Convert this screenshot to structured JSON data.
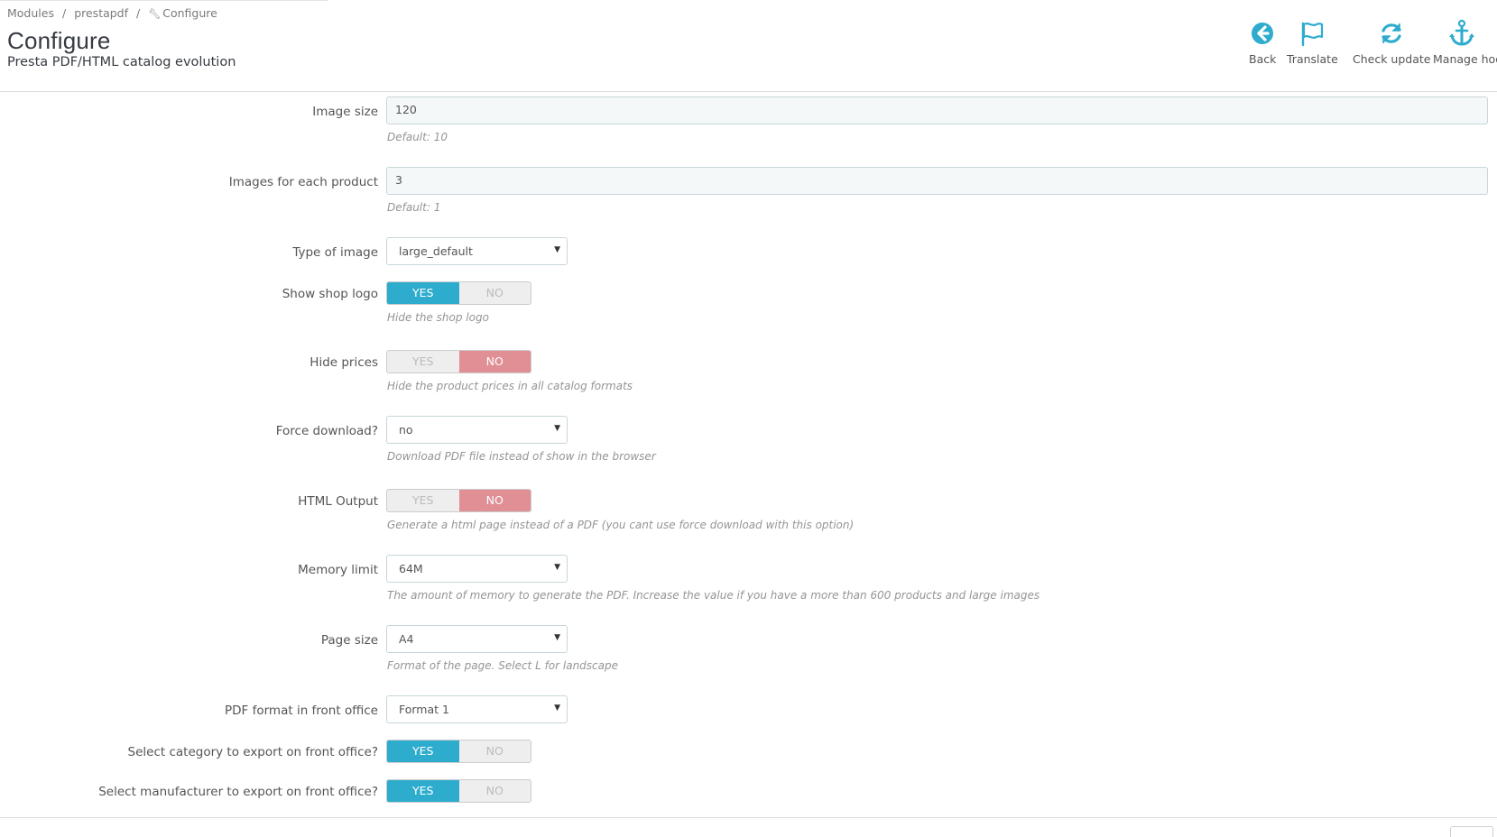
{
  "breadcrumb": {
    "items": [
      "Modules",
      "prestapdf"
    ],
    "separator": "/",
    "current": "Configure"
  },
  "header": {
    "title": "Configure",
    "subtitle": "Presta PDF/HTML catalog evolution"
  },
  "toolbar": {
    "accent_color": "#2eacce",
    "buttons": [
      {
        "label": "Back",
        "icon": "back-arrow-circle-icon"
      },
      {
        "label": "Translate",
        "icon": "flag-icon"
      },
      {
        "label": "Check update",
        "icon": "refresh-icon"
      },
      {
        "label": "Manage hoo",
        "icon": "anchor-icon"
      }
    ]
  },
  "form": {
    "image_size": {
      "label": "Image size",
      "value": "120",
      "help": "Default: 10"
    },
    "images_per_product": {
      "label": "Images for each product",
      "value": "3",
      "help": "Default: 1"
    },
    "image_type": {
      "label": "Type of image",
      "value": "large_default"
    },
    "show_logo": {
      "label": "Show shop logo",
      "yes": "YES",
      "no": "NO",
      "selected": "YES",
      "help": "Hide the shop logo"
    },
    "hide_prices": {
      "label": "Hide prices",
      "yes": "YES",
      "no": "NO",
      "selected": "NO",
      "help": "Hide the product prices in all catalog formats"
    },
    "force_download": {
      "label": "Force download?",
      "value": "no",
      "help": "Download PDF file instead of show in the browser"
    },
    "html_output": {
      "label": "HTML Output",
      "yes": "YES",
      "no": "NO",
      "selected": "NO",
      "help": "Generate a html page instead of a PDF (you cant use force download with this option)"
    },
    "memory_limit": {
      "label": "Memory limit",
      "value": "64M",
      "help": "The amount of memory to generate the PDF. Increase the value if you have a more than 600 products and large images"
    },
    "page_size": {
      "label": "Page size",
      "value": "A4",
      "help": "Format of the page. Select L for landscape"
    },
    "pdf_format": {
      "label": "PDF format in front office",
      "value": "Format 1"
    },
    "select_category": {
      "label": "Select category to export on front office?",
      "yes": "YES",
      "no": "NO",
      "selected": "YES"
    },
    "select_manufacturer": {
      "label": "Select manufacturer to export on front office?",
      "yes": "YES",
      "no": "NO",
      "selected": "YES"
    }
  },
  "colors": {
    "toggle_yes": "#2eacce",
    "toggle_no": "#e08f95",
    "input_background": "#f5f8f9"
  }
}
